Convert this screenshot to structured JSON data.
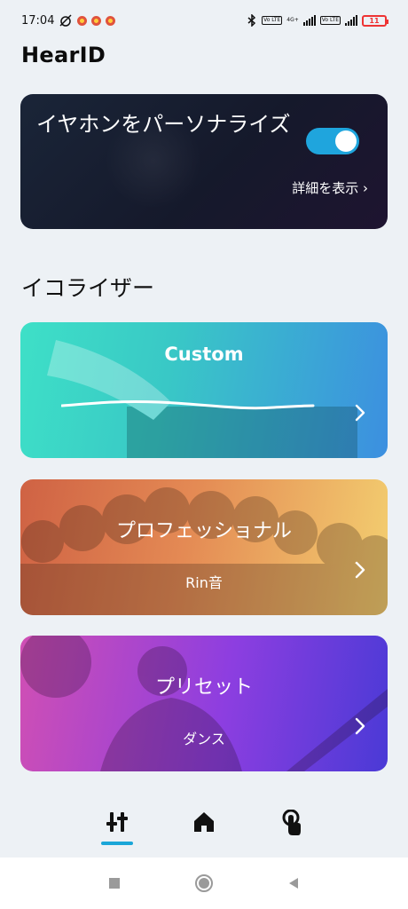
{
  "status_bar": {
    "time": "17:04",
    "signal_tag": "4G+",
    "volte_label": "Vo LTE",
    "battery_level": "11"
  },
  "app": {
    "title": "HearID"
  },
  "personalize": {
    "title": "イヤホンをパーソナライズ",
    "toggle_on": true,
    "details_label": "詳細を表示 ›"
  },
  "equalizer": {
    "section_title": "イコライザー",
    "cards": [
      {
        "title": "Custom",
        "subtitle": ""
      },
      {
        "title": "プロフェッショナル",
        "subtitle": "Rin音"
      },
      {
        "title": "プリセット",
        "subtitle": "ダンス"
      }
    ]
  },
  "bottom_nav": {
    "items": [
      "equalizer-icon",
      "home-icon",
      "touch-icon"
    ],
    "active": "equalizer-icon"
  },
  "colors": {
    "accent": "#1fa5dd",
    "background": "#edf1f5"
  }
}
